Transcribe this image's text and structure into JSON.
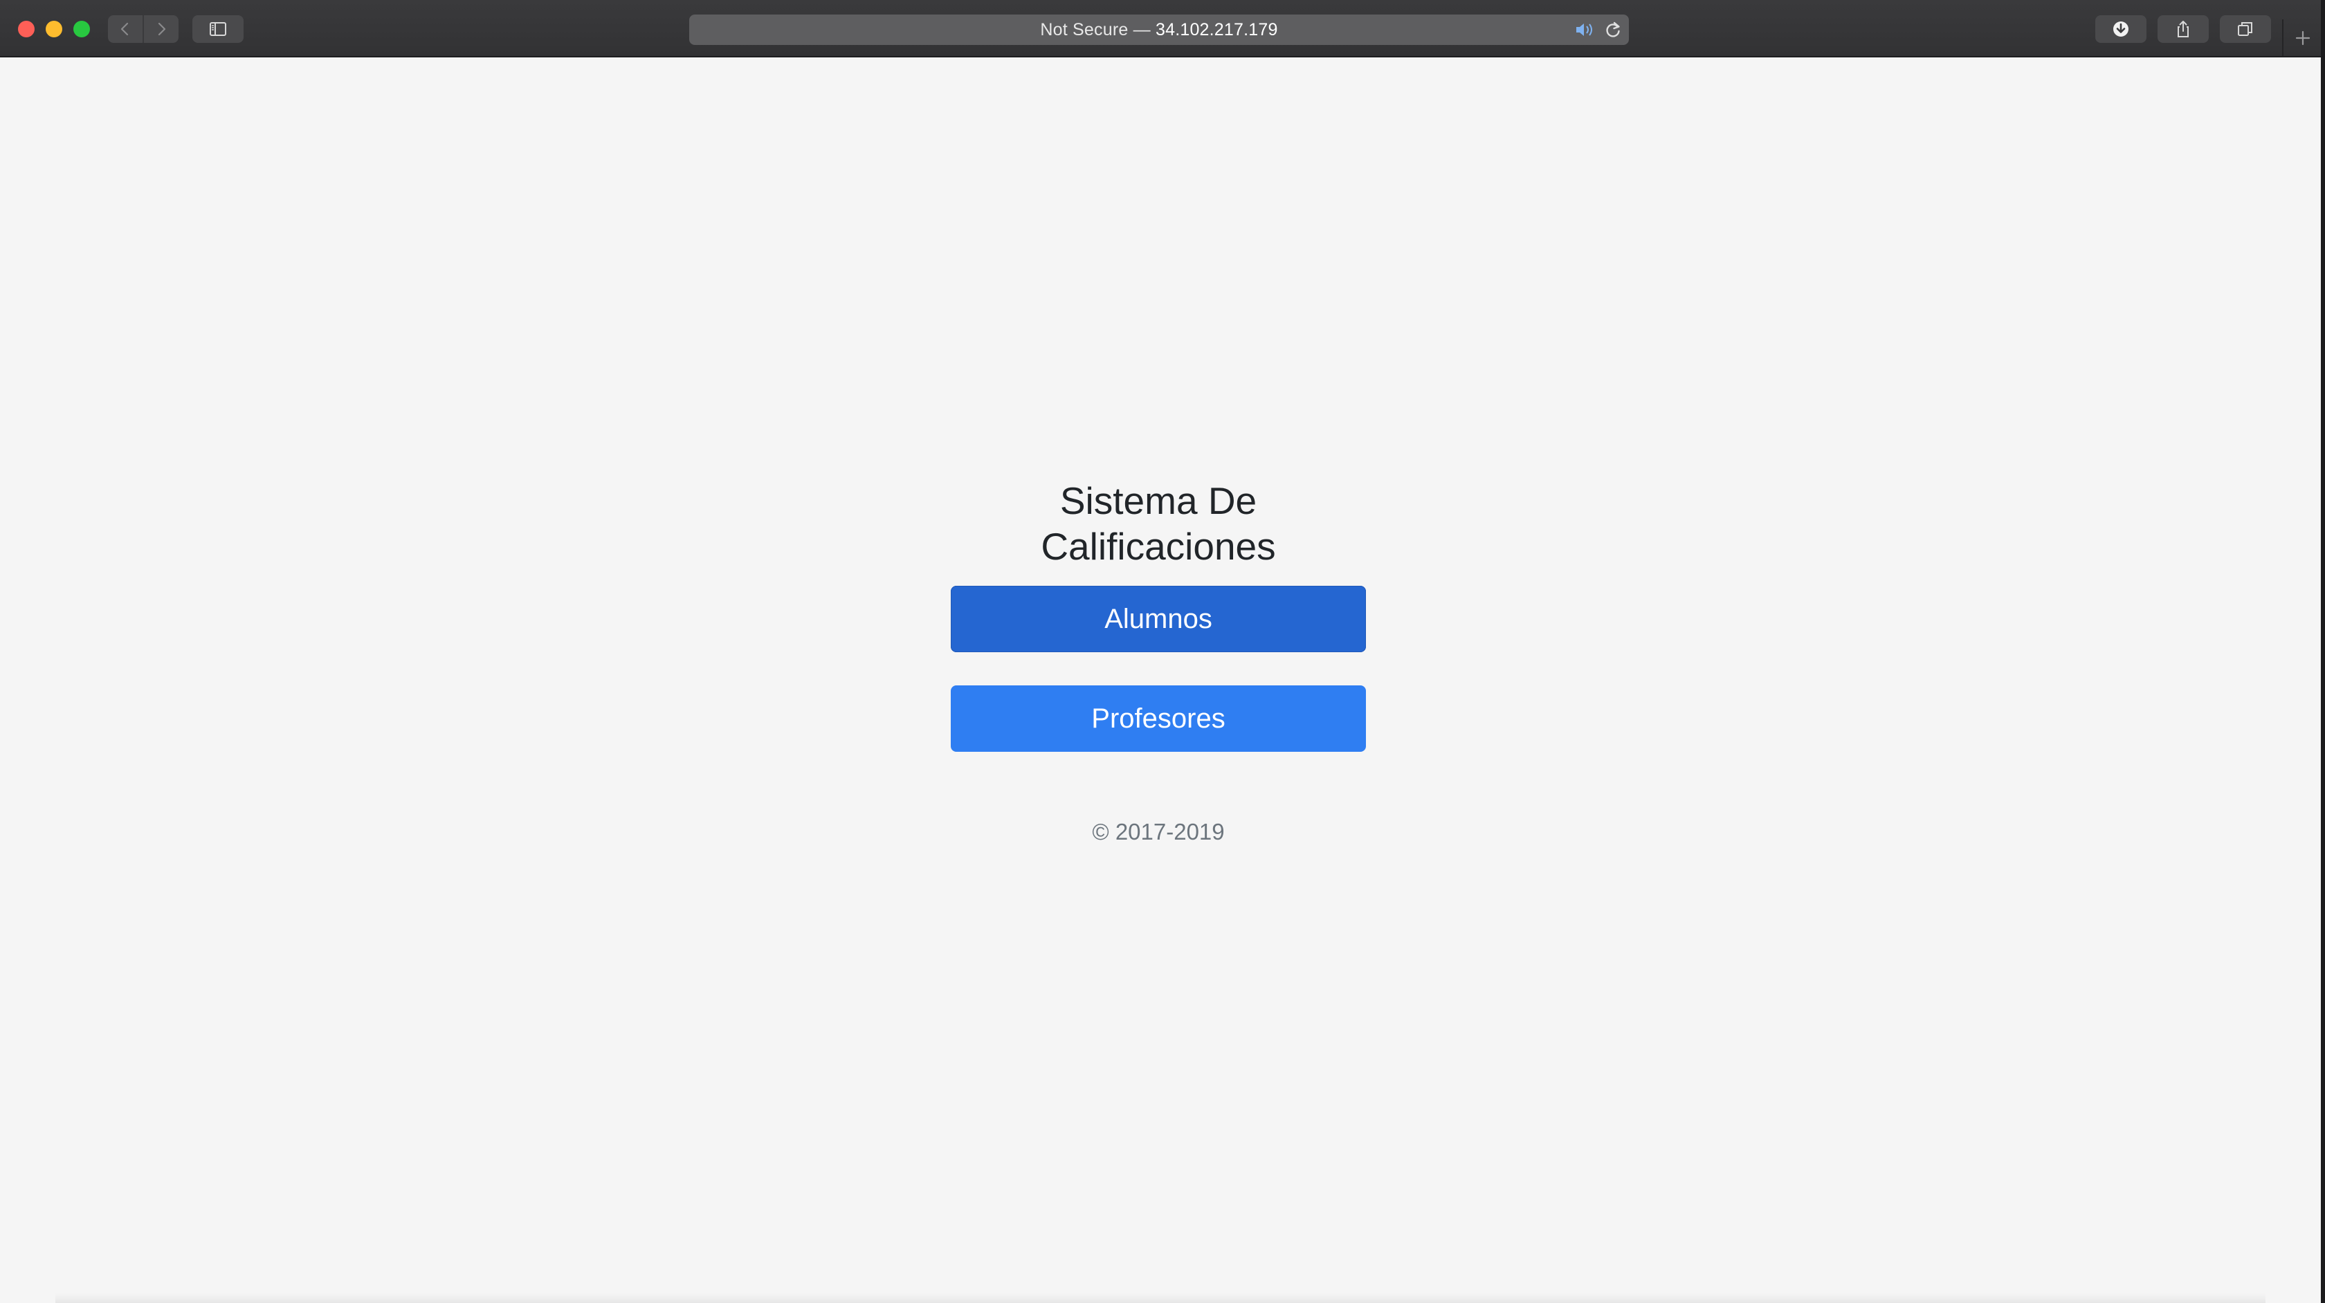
{
  "browser": {
    "url_security_label": "Not Secure",
    "url_separator": "—",
    "url_host": "34.102.217.179",
    "icons": {
      "back": "chevron-left-icon",
      "forward": "chevron-right-icon",
      "sidebar": "sidebar-icon",
      "speaker": "speaker-icon",
      "reload": "reload-icon",
      "download": "download-icon",
      "share": "share-icon",
      "tabs": "tabs-overview-icon",
      "new_tab": "plus-icon"
    }
  },
  "page": {
    "title_line1": "Sistema De",
    "title_line2": "Calificaciones",
    "buttons": {
      "alumnos": "Alumnos",
      "profesores": "Profesores"
    },
    "copyright": "© 2017-2019"
  },
  "colors": {
    "alumnos_button": "#2566d1",
    "profesores_button": "#2f7ef2",
    "page_background": "#f5f5f5",
    "title_text": "#212529",
    "muted_text": "#6c757d"
  }
}
